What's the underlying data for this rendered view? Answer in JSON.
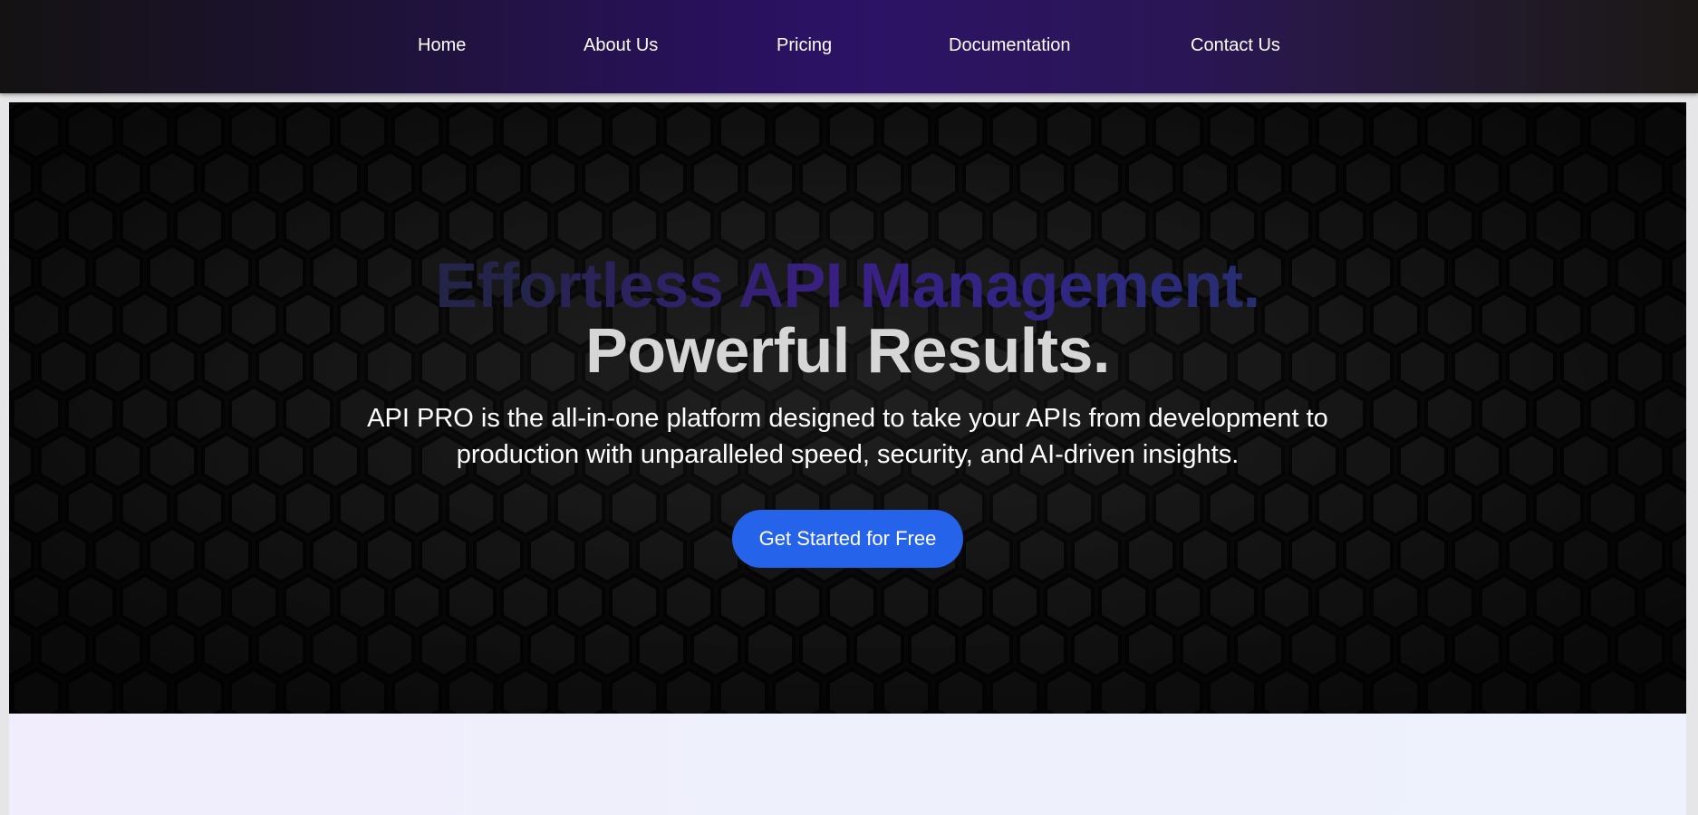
{
  "nav": {
    "items": [
      {
        "label": "Home"
      },
      {
        "label": "About Us"
      },
      {
        "label": "Pricing"
      },
      {
        "label": "Documentation"
      },
      {
        "label": "Contact Us"
      }
    ],
    "gradient_accent": "#2d1365"
  },
  "hero": {
    "headline_line1": "Effortless API Management.",
    "headline_line2": "Powerful Results.",
    "description": "API PRO is the all-in-one platform designed to take your APIs from development to production with unparalleled speed, security, and AI-driven insights.",
    "cta_label": "Get Started for Free",
    "background_pattern": "hexagon-pattern",
    "colors": {
      "cta": "#2563eb",
      "headline_line2": "#d6d6d6",
      "headline_line1_gradient": [
        "#24244a",
        "#3a1f86",
        "#262e6e"
      ]
    }
  }
}
